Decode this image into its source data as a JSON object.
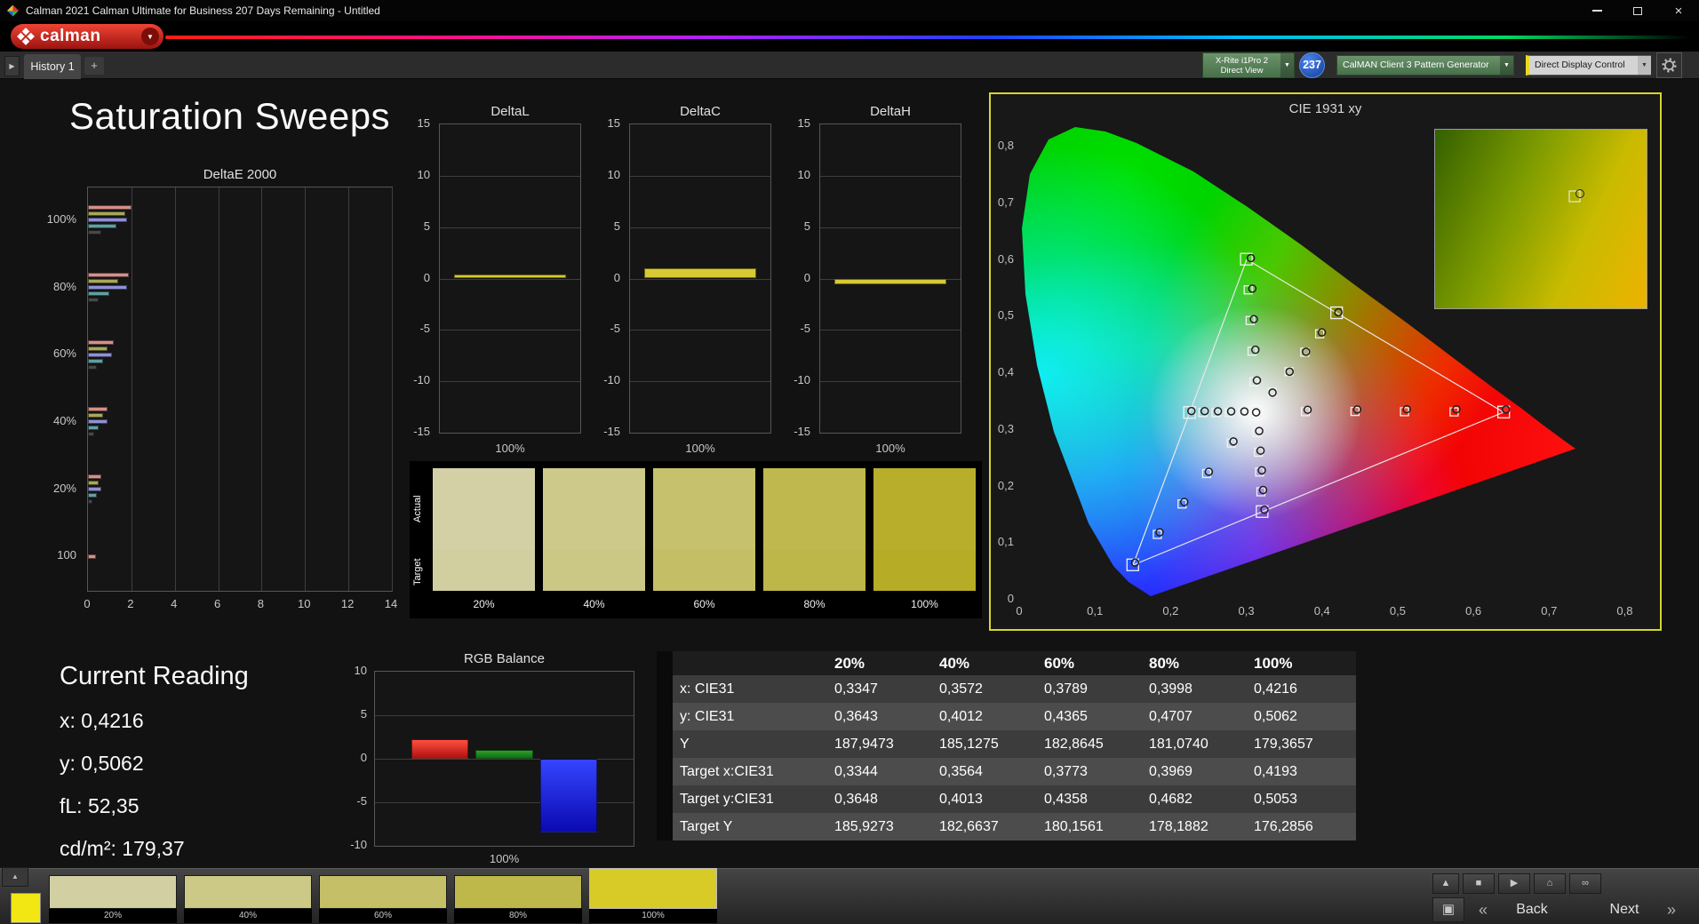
{
  "window": {
    "title": "Calman 2021 Calman Ultimate for Business 207 Days Remaining - Untitled"
  },
  "logo": {
    "text": "calman",
    "dropdown": "▼"
  },
  "device_bar": {
    "meter_line1": "X-Rite i1Pro 2",
    "meter_line2": "Direct View",
    "badge": "237",
    "generator": "CalMAN Client 3 Pattern Generator",
    "display_control": "Direct Display Control",
    "dropdown": "▼"
  },
  "tab_bar": {
    "expand": "▶",
    "tab": "History 1",
    "add": "+"
  },
  "page_title": "Saturation Sweeps",
  "deltae_chart": {
    "title": "DeltaE 2000",
    "xticks": [
      0,
      2,
      4,
      6,
      8,
      10,
      12,
      14
    ],
    "xmax": 14,
    "bar_colors": [
      "#d4908c",
      "#a8a858",
      "#9090d8",
      "#60a0a0",
      "#484848"
    ],
    "groups": [
      {
        "label": "100%",
        "values": [
          2.0,
          1.7,
          1.8,
          1.3,
          0.6
        ]
      },
      {
        "label": "80%",
        "values": [
          1.9,
          1.4,
          1.8,
          1.0,
          0.5
        ]
      },
      {
        "label": "60%",
        "values": [
          1.2,
          0.9,
          1.1,
          0.7,
          0.4
        ]
      },
      {
        "label": "40%",
        "values": [
          0.9,
          0.7,
          0.9,
          0.5,
          0.3
        ]
      },
      {
        "label": "20%",
        "values": [
          0.6,
          0.5,
          0.6,
          0.4,
          0.2
        ]
      },
      {
        "label": "100",
        "values": [
          0.35
        ]
      }
    ]
  },
  "delta_axis": {
    "ymin": -15,
    "ymax": 15,
    "yticks": [
      15,
      10,
      5,
      0,
      -5,
      -10,
      -15
    ]
  },
  "delta_charts": [
    {
      "title": "DeltaL",
      "xlabel": "100%",
      "value": 0.4
    },
    {
      "title": "DeltaC",
      "xlabel": "100%",
      "value": 1.0
    },
    {
      "title": "DeltaH",
      "xlabel": "100%",
      "value": -0.6
    }
  ],
  "rgb_chart": {
    "title": "RGB Balance",
    "xlabel": "100%",
    "ymin": -10,
    "ymax": 10,
    "yticks": [
      10,
      5,
      0,
      -5,
      -10
    ],
    "bars": [
      {
        "name": "red",
        "value": 2.2
      },
      {
        "name": "green",
        "value": 1.0
      },
      {
        "name": "blue",
        "value": -8.5
      }
    ]
  },
  "swatch_panel": {
    "actual_label": "Actual",
    "target_label": "Target",
    "swatches": [
      {
        "label": "20%",
        "actual": "#d3d0a6",
        "target": "#d1cea0"
      },
      {
        "label": "40%",
        "actual": "#cdc98a",
        "target": "#cbc784"
      },
      {
        "label": "60%",
        "actual": "#c6c16c",
        "target": "#c4bf66"
      },
      {
        "label": "80%",
        "actual": "#bfb84e",
        "target": "#bdb648"
      },
      {
        "label": "100%",
        "actual": "#b8ae2c",
        "target": "#b6ac26"
      }
    ]
  },
  "cie_chart": {
    "title": "CIE 1931 xy",
    "xtick_labels": [
      "0",
      "0,1",
      "0,2",
      "0,3",
      "0,4",
      "0,5",
      "0,6",
      "0,7",
      "0,8"
    ],
    "ytick_labels": [
      "0",
      "0,1",
      "0,2",
      "0,3",
      "0,4",
      "0,5",
      "0,6",
      "0,7",
      "0,8"
    ],
    "targets": [
      [
        0.3127,
        0.329,
        11
      ],
      [
        0.3344,
        0.3648,
        9
      ],
      [
        0.3564,
        0.4013,
        9
      ],
      [
        0.3773,
        0.4358,
        9
      ],
      [
        0.3969,
        0.4682,
        9
      ],
      [
        0.4193,
        0.5053,
        13
      ],
      [
        0.3781,
        0.3306,
        9
      ],
      [
        0.4436,
        0.331,
        9
      ],
      [
        0.509,
        0.3306,
        9
      ],
      [
        0.5745,
        0.3303,
        9
      ],
      [
        0.64,
        0.33,
        13
      ],
      [
        0.3102,
        0.3832,
        9
      ],
      [
        0.3076,
        0.4374,
        9
      ],
      [
        0.3051,
        0.4916,
        9
      ],
      [
        0.3025,
        0.5458,
        9
      ],
      [
        0.3,
        0.6,
        13
      ],
      [
        0.2802,
        0.2752,
        9
      ],
      [
        0.2476,
        0.2214,
        9
      ],
      [
        0.2151,
        0.1676,
        9
      ],
      [
        0.1825,
        0.1138,
        9
      ],
      [
        0.15,
        0.06,
        13
      ],
      [
        0.3143,
        0.294,
        9
      ],
      [
        0.316,
        0.259,
        9
      ],
      [
        0.3176,
        0.2241,
        9
      ],
      [
        0.3193,
        0.1891,
        9
      ],
      [
        0.3209,
        0.1542,
        13
      ],
      [
        0.2952,
        0.329,
        9
      ],
      [
        0.2777,
        0.3291,
        9
      ],
      [
        0.2601,
        0.3291,
        9
      ],
      [
        0.2426,
        0.3292,
        9
      ],
      [
        0.225,
        0.3292,
        13
      ]
    ],
    "measured": [
      [
        0.313,
        0.3295
      ],
      [
        0.3347,
        0.3643
      ],
      [
        0.3572,
        0.4012
      ],
      [
        0.3789,
        0.4365
      ],
      [
        0.3998,
        0.4707
      ],
      [
        0.4216,
        0.5062
      ],
      [
        0.381,
        0.334
      ],
      [
        0.4465,
        0.3345
      ],
      [
        0.512,
        0.335
      ],
      [
        0.5775,
        0.335
      ],
      [
        0.643,
        0.3345
      ],
      [
        0.314,
        0.386
      ],
      [
        0.312,
        0.44
      ],
      [
        0.31,
        0.494
      ],
      [
        0.308,
        0.548
      ],
      [
        0.306,
        0.602
      ],
      [
        0.283,
        0.278
      ],
      [
        0.2505,
        0.2245
      ],
      [
        0.218,
        0.171
      ],
      [
        0.1855,
        0.1175
      ],
      [
        0.153,
        0.064
      ],
      [
        0.317,
        0.2965
      ],
      [
        0.3188,
        0.2618
      ],
      [
        0.3205,
        0.227
      ],
      [
        0.3222,
        0.1922
      ],
      [
        0.324,
        0.1575
      ],
      [
        0.2975,
        0.331
      ],
      [
        0.28,
        0.3312
      ],
      [
        0.2625,
        0.3314
      ],
      [
        0.245,
        0.3316
      ],
      [
        0.2275,
        0.3318
      ]
    ],
    "inset": {
      "xrange": [
        0.36,
        0.45
      ],
      "yrange": [
        0.455,
        0.535
      ],
      "square": [
        0.4193,
        0.5053
      ],
      "circle": [
        0.4216,
        0.5062
      ]
    }
  },
  "current_reading": {
    "title": "Current Reading",
    "line_x": "x: 0,4216",
    "line_y": "y: 0,5062",
    "line_fl": "fL: 52,35",
    "line_cd": "cd/m²: 179,37"
  },
  "table": {
    "columns": [
      "20%",
      "40%",
      "60%",
      "80%",
      "100%"
    ],
    "rows": [
      {
        "label": "x: CIE31",
        "values": [
          "0,3347",
          "0,3572",
          "0,3789",
          "0,3998",
          "0,4216"
        ]
      },
      {
        "label": "y: CIE31",
        "values": [
          "0,3643",
          "0,4012",
          "0,4365",
          "0,4707",
          "0,5062"
        ]
      },
      {
        "label": "Y",
        "values": [
          "187,9473",
          "185,1275",
          "182,8645",
          "181,0740",
          "179,3657"
        ]
      },
      {
        "label": "Target x:CIE31",
        "values": [
          "0,3344",
          "0,3564",
          "0,3773",
          "0,3969",
          "0,4193"
        ]
      },
      {
        "label": "Target y:CIE31",
        "values": [
          "0,3648",
          "0,4013",
          "0,4358",
          "0,4682",
          "0,5053"
        ]
      },
      {
        "label": "Target Y",
        "values": [
          "185,9273",
          "182,6637",
          "180,1561",
          "178,1882",
          "176,2856"
        ]
      }
    ]
  },
  "bottom_bar": {
    "selected_index": 4,
    "swatches": [
      {
        "label": "20%",
        "color": "#d2cfa2"
      },
      {
        "label": "40%",
        "color": "#ccc886"
      },
      {
        "label": "60%",
        "color": "#c5c068"
      },
      {
        "label": "80%",
        "color": "#beb74a"
      },
      {
        "label": "100%",
        "color": "#d9cb27"
      }
    ],
    "icons": {
      "up": "▲",
      "stop": "■",
      "play": "▶",
      "home": "⌂",
      "loop": "∞",
      "pattern": "▣"
    },
    "prev_icon": "«",
    "next_icon": "»",
    "back": "Back",
    "next": "Next"
  }
}
